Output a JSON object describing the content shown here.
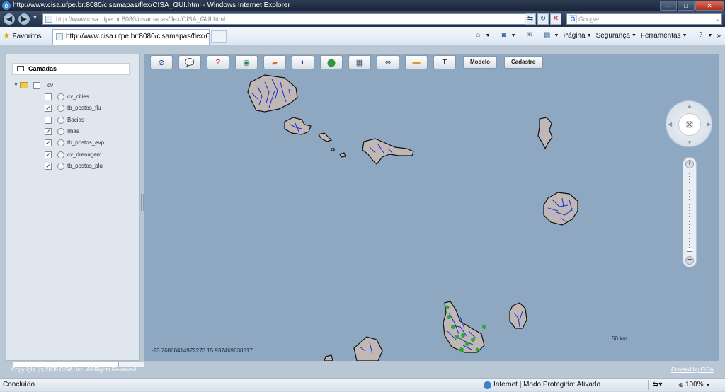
{
  "window": {
    "title": "http://www.cisa.ufpe.br:8080/cisamapas/flex/CISA_GUI.html - Windows Internet Explorer",
    "minimize": "—",
    "maximize": "□",
    "close": "✕"
  },
  "nav": {
    "url": "http://www.cisa.ufpe.br:8080/cisamapas/flex/CISA_GUI.html",
    "search_placeholder": "Google"
  },
  "favorites": {
    "label": "Favoritos",
    "tab_title": "http://www.cisa.ufpe.br:8080/cisamapas/flex/CIS..."
  },
  "commandbar": {
    "page": "Página",
    "safety": "Segurança",
    "tools": "Ferramentas",
    "more": "»"
  },
  "layers": {
    "header": "Camadas",
    "root_label": "cv",
    "items": [
      {
        "label": "cv_cities",
        "checked": ""
      },
      {
        "label": "tb_postos_flu",
        "checked": "✓"
      },
      {
        "label": "Bacias",
        "checked": ""
      },
      {
        "label": "Ilhas",
        "checked": "✓"
      },
      {
        "label": "tb_postos_evp",
        "checked": "✓"
      },
      {
        "label": "cv_drenagem",
        "checked": "✓"
      },
      {
        "label": "tb_postos_plu",
        "checked": "✓"
      }
    ]
  },
  "toolbar": {
    "icons": [
      "globe-compass-icon",
      "speech-bubble-icon",
      "help-icon",
      "world-icon",
      "eraser-icon",
      "compass-icon",
      "stop-icon",
      "measure-table-icon",
      "binoculars-icon",
      "ruler-icon",
      "hammer-icon"
    ],
    "modelo": "Modelo",
    "cadastro": "Cadastro"
  },
  "map": {
    "coordinates": "-23.76868414972273 15.937469038817",
    "scale_label": "50 km",
    "land_color": "#bfb8b6",
    "river_color": "#1c2cd6",
    "station_color": "#2fa830",
    "water_color": "#8fa8c2"
  },
  "footer": {
    "copyright": "Copyright (c) 2009 CISA, Inc. All Rights Reserved",
    "created_by": "Created by CISA"
  },
  "status": {
    "done": "Concluído",
    "zone": "Internet | Modo Protegido: Ativado",
    "zoom": "100%"
  }
}
